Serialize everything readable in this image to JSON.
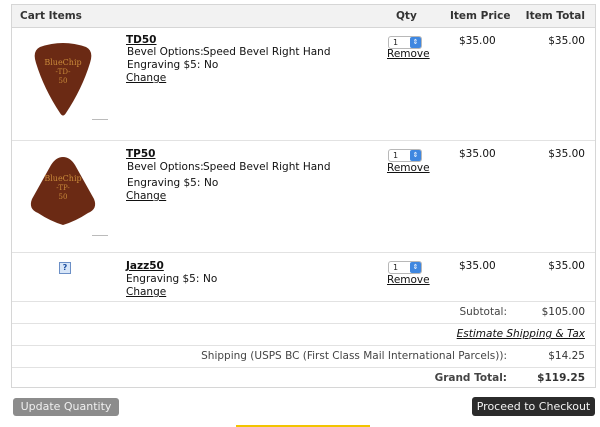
{
  "header": {
    "cart_items": "Cart Items",
    "qty": "Qty",
    "item_price": "Item Price",
    "item_total": "Item Total"
  },
  "items": [
    {
      "name": "TD50",
      "pick_text": [
        "BlueChip",
        "-TD-",
        "50"
      ],
      "options": [
        {
          "label": "Bevel Options:",
          "value": "Speed Bevel Right Hand"
        },
        {
          "label": "Engraving $5:",
          "value": "No"
        }
      ],
      "change": "Change",
      "qty": "1",
      "remove": "Remove",
      "price": "$35.00",
      "total": "$35.00"
    },
    {
      "name": "TP50",
      "pick_text": [
        "BlueChip",
        "-TP-",
        "50"
      ],
      "options": [
        {
          "label": "Bevel Options:",
          "value": "Speed Bevel Right Hand"
        },
        {
          "label": "Engraving $5:",
          "value": "No"
        }
      ],
      "change": "Change",
      "qty": "1",
      "remove": "Remove",
      "price": "$35.00",
      "total": "$35.00"
    },
    {
      "name": "Jazz50",
      "options": [
        {
          "label": "Engraving $5:",
          "value": "No"
        }
      ],
      "change": "Change",
      "qty": "1",
      "remove": "Remove",
      "price": "$35.00",
      "total": "$35.00"
    }
  ],
  "summary": {
    "subtotal_label": "Subtotal:",
    "subtotal_value": "$105.00",
    "estimate_link": "Estimate Shipping & Tax",
    "shipping_label": "Shipping (USPS BC (First Class Mail International Parcels)):",
    "shipping_value": "$14.25",
    "grand_total_label": "Grand Total:",
    "grand_total_value": "$119.25"
  },
  "buttons": {
    "update": "Update Quantity",
    "checkout": "Proceed to Checkout"
  },
  "colors": {
    "pick_fill": "#6b2a14",
    "pick_text": "#c98a3a",
    "select_arrow": "#3f87e0",
    "checkout_bg": "#2b2b2b",
    "update_bg": "#8c8c8c"
  }
}
